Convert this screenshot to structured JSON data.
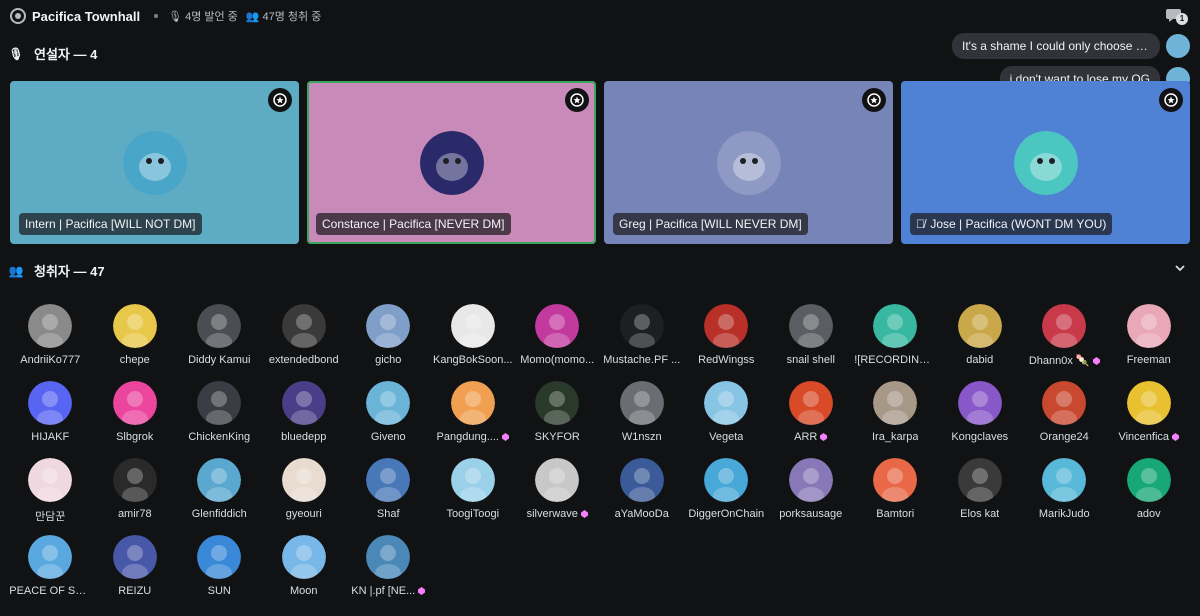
{
  "header": {
    "title": "Pacifica Townhall",
    "speaking_count": "4명 발언 중",
    "listening_count": "47명 청취 중",
    "chat_badge": "1"
  },
  "speakers_section": {
    "label": "연설자 — 4"
  },
  "audience_section": {
    "label": "청취자 — 47"
  },
  "chat_messages": [
    {
      "text": "It's a shame I could only choose o...",
      "avatar_color": "#6fb4d8"
    },
    {
      "text": "i don't want to lose my OG",
      "avatar_color": "#6fb4d8"
    }
  ],
  "speakers": [
    {
      "name": "Intern | Pacifica [WILL NOT DM]",
      "tile_color": "#5eacc4",
      "avatar_color": "#4aa6c9",
      "active": false,
      "muted": false
    },
    {
      "name": "Constance | Pacifica [NEVER DM]",
      "tile_color": "#c88ab8",
      "avatar_color": "#2a2a6a",
      "active": true,
      "muted": false
    },
    {
      "name": "Greg | Pacifica [WILL NEVER DM]",
      "tile_color": "#7684b8",
      "avatar_color": "#8e9ac4",
      "active": false,
      "muted": false
    },
    {
      "name": "Jose | Pacifica (WONT DM YOU)",
      "tile_color": "#4f82d4",
      "avatar_color": "#4bc6c0",
      "active": false,
      "muted": true
    }
  ],
  "audience": [
    {
      "name": "AndriiKo777",
      "color": "#8a8a8a",
      "boost": false
    },
    {
      "name": "chepe",
      "color": "#e8c84a",
      "boost": false
    },
    {
      "name": "Diddy Kamui",
      "color": "#4a4e52",
      "boost": false
    },
    {
      "name": "extendedbond",
      "color": "#3a3a3a",
      "boost": false
    },
    {
      "name": "gicho",
      "color": "#7f9ec8",
      "boost": false
    },
    {
      "name": "KangBokSoon...",
      "color": "#e8e8e8",
      "boost": false
    },
    {
      "name": "Momo(momo...",
      "color": "#c23a9e",
      "boost": false
    },
    {
      "name": "Mustache.PF ...",
      "color": "#1e1f22",
      "boost": false
    },
    {
      "name": "RedWingss",
      "color": "#b83028",
      "boost": false
    },
    {
      "name": "snail shell",
      "color": "#5a5e62",
      "boost": false
    },
    {
      "name": "![RECORDING...",
      "color": "#38b8a0",
      "boost": false
    },
    {
      "name": "dabid",
      "color": "#c8a848",
      "boost": false
    },
    {
      "name": "Dhann0x 🍡",
      "color": "#c83a4a",
      "boost": true
    },
    {
      "name": "Freeman",
      "color": "#e8a8b8",
      "boost": false
    },
    {
      "name": "HIJAKF",
      "color": "#5865f2",
      "boost": false
    },
    {
      "name": "Slbgrok",
      "color": "#eb459e",
      "boost": false
    },
    {
      "name": "ChickenKing",
      "color": "#3a3e44",
      "boost": false
    },
    {
      "name": "bluedepp",
      "color": "#4a3e88",
      "boost": false
    },
    {
      "name": "Giveno",
      "color": "#6ab4d8",
      "boost": false
    },
    {
      "name": "Pangdung....",
      "color": "#f0a050",
      "boost": true
    },
    {
      "name": "SKYFOR",
      "color": "#2a3a2a",
      "boost": false
    },
    {
      "name": "W1nszn",
      "color": "#6a6e72",
      "boost": false
    },
    {
      "name": "Vegeta",
      "color": "#88c4e4",
      "boost": false
    },
    {
      "name": "ARR",
      "color": "#d84a28",
      "boost": true
    },
    {
      "name": "Ira_karpa",
      "color": "#a89888",
      "boost": false
    },
    {
      "name": "Kongclaves",
      "color": "#8858c8",
      "boost": false
    },
    {
      "name": "Orange24",
      "color": "#c84830",
      "boost": false
    },
    {
      "name": "Vincenfica",
      "color": "#e8c030",
      "boost": true
    },
    {
      "name": "만담꾼",
      "color": "#f0d8e0",
      "boost": false
    },
    {
      "name": "amir78",
      "color": "#2a2a2a",
      "boost": false
    },
    {
      "name": "Glenfiddich",
      "color": "#5aa8d0",
      "boost": false
    },
    {
      "name": "gyeouri",
      "color": "#e8dcd0",
      "boost": false
    },
    {
      "name": "Shaf",
      "color": "#4878b8",
      "boost": false
    },
    {
      "name": "ToogiToogi",
      "color": "#9ad0e8",
      "boost": false
    },
    {
      "name": "silverwave",
      "color": "#c8c8c8",
      "boost": true
    },
    {
      "name": "aYaMooDa",
      "color": "#3a5a98",
      "boost": false
    },
    {
      "name": "DiggerOnChain",
      "color": "#48a8d8",
      "boost": false
    },
    {
      "name": "porksausage",
      "color": "#8878b8",
      "boost": false
    },
    {
      "name": "Bamtori",
      "color": "#e86848",
      "boost": false
    },
    {
      "name": "Elos kat",
      "color": "#3a3a3a",
      "boost": false
    },
    {
      "name": "MarikJudo",
      "color": "#58b8d8",
      "boost": false
    },
    {
      "name": "adov",
      "color": "#18a878",
      "boost": false
    },
    {
      "name": "PEACE OF SH...",
      "color": "#5aa8e0",
      "boost": false
    },
    {
      "name": "REIZU",
      "color": "#4858a8",
      "boost": false
    },
    {
      "name": "SUN",
      "color": "#3a88d8",
      "boost": false
    },
    {
      "name": "Moon",
      "color": "#78b8e8",
      "boost": false
    },
    {
      "name": "KN |.pf [NE...",
      "color": "#4a88b8",
      "boost": true
    }
  ],
  "colors": {
    "background": "#111214",
    "active_outline": "#3ba55c",
    "boost_pink": "#f47fff"
  }
}
